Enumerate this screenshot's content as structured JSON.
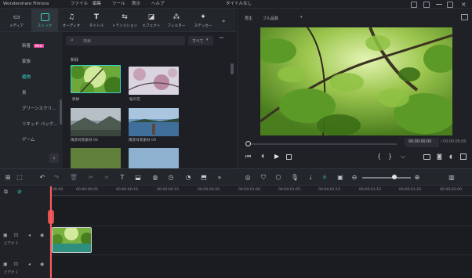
{
  "app": {
    "name": "Wondershare Filmora",
    "menu": [
      "ファイル",
      "編集",
      "ツール",
      "表示",
      "ヘルプ"
    ],
    "title": "タイトルなし"
  },
  "tool_tabs": [
    {
      "label": "メディア",
      "icon": "media-icon"
    },
    {
      "label": "ストック",
      "icon": "stock-icon",
      "active": true
    },
    {
      "label": "オーディオ",
      "icon": "music-note-icon"
    },
    {
      "label": "タイトル",
      "icon": "title-t-icon"
    },
    {
      "label": "トランジション",
      "icon": "transition-icon"
    },
    {
      "label": "エフェクト",
      "icon": "effect-icon"
    },
    {
      "label": "フィルター",
      "icon": "filter-icon"
    },
    {
      "label": "ステッカー",
      "icon": "sticker-icon"
    }
  ],
  "categories": [
    {
      "label": "新着",
      "badge": "New"
    },
    {
      "label": "家族"
    },
    {
      "label": "植物",
      "active": true
    },
    {
      "label": "鳥"
    },
    {
      "label": "グリーンスクリ..."
    },
    {
      "label": "リキッド バック..."
    },
    {
      "label": "ゲーム"
    }
  ],
  "search": {
    "placeholder": "検索",
    "filter": "すべて"
  },
  "section_title": "新緑",
  "media_items": [
    {
      "label": "新緑",
      "selected": true
    },
    {
      "label": "桜の花"
    },
    {
      "label": "風景背景素材 06"
    },
    {
      "label": "風景背景素材 09"
    }
  ],
  "preview": {
    "quality": "再生",
    "zoom": "フル品質",
    "current_time": "00:00:00:00",
    "total_time": "/ 00:00:05:00",
    "progress": 0
  },
  "ruler_ticks": [
    "00:00",
    "00:00:00:05",
    "00:00:00:10",
    "00:00:00:15",
    "00:00:00:20",
    "00:00:01:00",
    "00:00:01:05",
    "00:00:01:10",
    "00:00:01:15",
    "00:00:01:20",
    "00:00:02:00",
    "00:00:02:05"
  ],
  "tracks": [
    {
      "label": "ビデオ 2"
    },
    {
      "label": "ビデオ 1"
    }
  ],
  "colors": {
    "accent": "#35d3c2",
    "playhead": "#ff5b5b",
    "clip": "#2f8f7e"
  }
}
